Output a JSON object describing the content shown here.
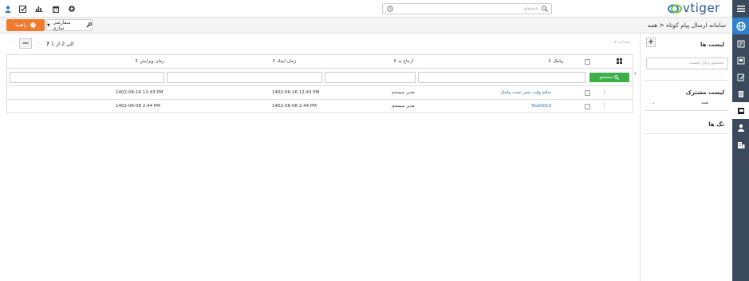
{
  "topbar": {
    "search_placeholder": "جستجو",
    "logo_text": "vtiger",
    "icons": [
      "add-icon",
      "calendar-icon",
      "reports-icon",
      "tasks-icon",
      "user-icon",
      "search-icon",
      "filter-icon"
    ]
  },
  "subbar": {
    "breadcrumb_module": "سامانه ارسال پیام کوتاه",
    "breadcrumb_sep": "<",
    "breadcrumb_current": "همه",
    "help_label": "راهنما",
    "customize_label": "سفارشی سازی"
  },
  "sidebar": {
    "lists_title": "لیست ها",
    "add_label": "+",
    "search_placeholder": "جستجو برای لیست",
    "shared_title": "لیست مشترک",
    "shared_item": "همه",
    "tags_title": "تگ ها"
  },
  "toolbar": {
    "actions_label": "عملیات",
    "pager_text": "1 الی 2  از",
    "pager_total": "?",
    "more_label": "—"
  },
  "table": {
    "columns": {
      "message": "پیامک",
      "assigned": "ارجاع به",
      "created": "زمان ایجاد",
      "modified": "زمان ویرایش"
    },
    "search_button": "جستجو",
    "rows": [
      {
        "message": "سلام وقت بخیر تست پیامک",
        "assigned": "مدیر سیستم",
        "created": "1402-06-16 12:43 PM",
        "modified": "1402-06-16 12:43 PM"
      },
      {
        "message": "Test0010",
        "assigned": "مدیر سیستم",
        "created": "1402-06-08 2:44 PM",
        "modified": "1402-06-08 2:44 PM"
      }
    ]
  },
  "colors": {
    "nav_bg": "#3a4a5c",
    "accent": "#2f80c9",
    "help_orange": "#f07b2e",
    "search_green": "#3cae4a",
    "link_blue": "#2b6cb0"
  }
}
